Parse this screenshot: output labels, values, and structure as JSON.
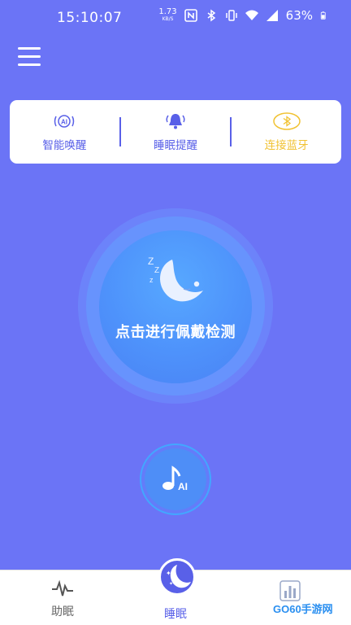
{
  "status_bar": {
    "time": "15:10:07",
    "net_speed_value": "1.73",
    "net_speed_unit": "KB/S",
    "battery_percent": "63%",
    "icons": [
      "nfc-icon",
      "bluetooth-icon",
      "vibrate-icon",
      "wifi-icon",
      "signal-5g-icon",
      "battery-icon"
    ]
  },
  "features": [
    {
      "label": "智能唤醒",
      "icon": "ai-wave-icon"
    },
    {
      "label": "睡眠提醒",
      "icon": "bell-icon"
    },
    {
      "label": "连接蓝牙",
      "icon": "bluetooth-icon"
    }
  ],
  "main": {
    "detect_label": "点击进行佩戴检测",
    "moon_icon": "sleeping-moon-icon",
    "ai_button_icon": "music-note-ai-icon",
    "ai_text": "AI"
  },
  "bottom_nav": {
    "items": [
      {
        "label": "助眠",
        "icon": "heartbeat-icon"
      },
      {
        "label": "睡眠",
        "icon": "moon-icon",
        "active": true
      },
      {
        "label": "",
        "icon": "bar-chart-icon"
      }
    ]
  },
  "watermark": {
    "text": "GO60手游网"
  },
  "colors": {
    "background": "#6b74f6",
    "accent": "#5960e8",
    "bluetooth_label": "#f1c232",
    "circle": "#4e92fb"
  }
}
